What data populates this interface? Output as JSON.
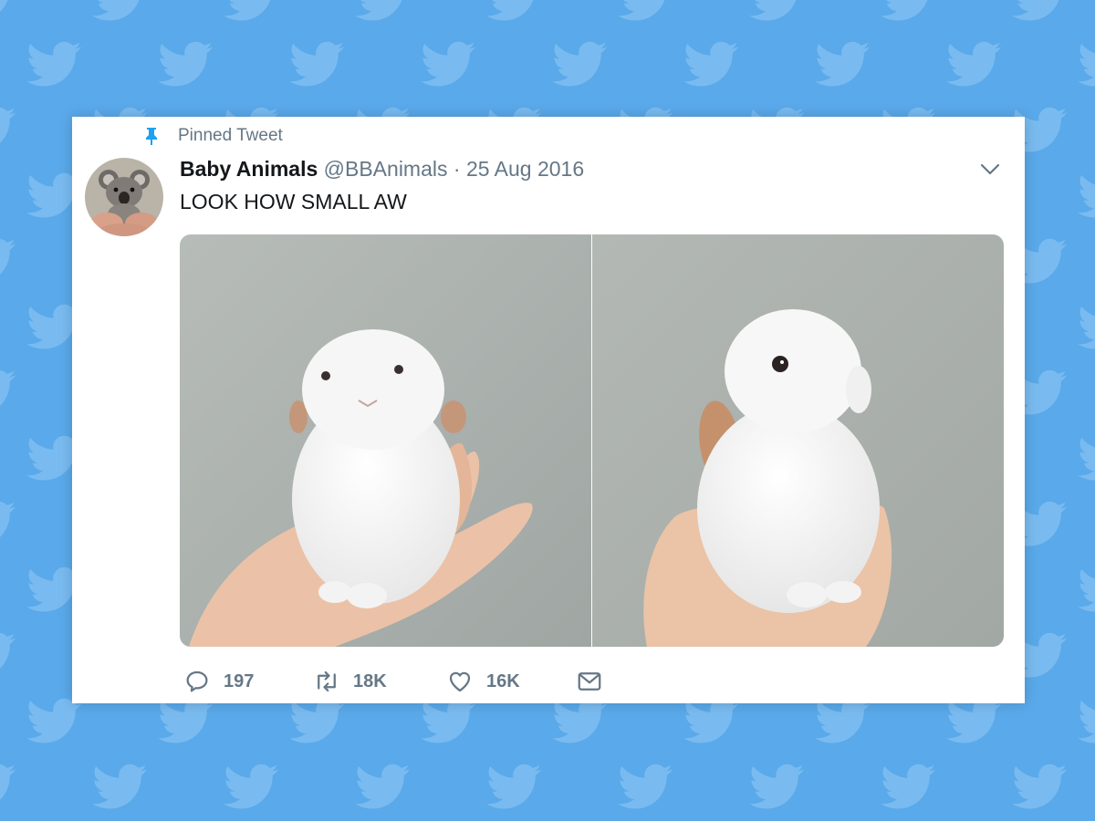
{
  "colors": {
    "background": "#5aa9ea",
    "bird_pattern": "#79bbf0",
    "pin_accent": "#1da1f2",
    "secondary_text": "#657786",
    "primary_text": "#14171a"
  },
  "tweet": {
    "pinned_label": "Pinned Tweet",
    "display_name": "Baby Animals",
    "handle": "@BBAnimals",
    "separator": "·",
    "date": "25 Aug 2016",
    "text": "LOOK HOW SMALL AW",
    "media": [
      {
        "subject": "white bunny sitting on palm, facing forward"
      },
      {
        "subject": "white bunny sitting on palm, side profile"
      }
    ],
    "actions": {
      "reply_count": "197",
      "retweet_count": "18K",
      "like_count": "16K"
    }
  },
  "icons": {
    "pin": "pin-icon",
    "caret": "chevron-down-icon",
    "reply": "reply-icon",
    "retweet": "retweet-icon",
    "like": "heart-icon",
    "message": "envelope-icon",
    "background": "bird-icon"
  }
}
